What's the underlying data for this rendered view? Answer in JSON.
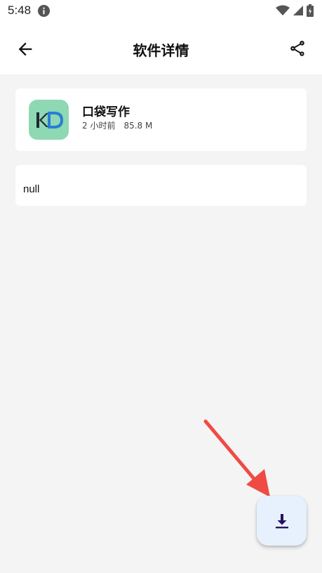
{
  "status_bar": {
    "time": "5:48",
    "icons": [
      "info-icon",
      "wifi-icon",
      "signal-icon",
      "battery-icon"
    ]
  },
  "app_bar": {
    "title": "软件详情",
    "back_icon": "arrow-back-icon",
    "share_icon": "share-icon"
  },
  "app_info": {
    "name": "口袋写作",
    "updated": "2 小时前",
    "size": "85.8 M",
    "icon_color": "#8ed8b4"
  },
  "description": {
    "text": "null"
  },
  "fab": {
    "icon": "download-icon",
    "color": "#e6f1fd",
    "icon_color": "#2b1064"
  },
  "colors": {
    "background": "#f4f4f4",
    "annotation_arrow": "#f04a45"
  }
}
